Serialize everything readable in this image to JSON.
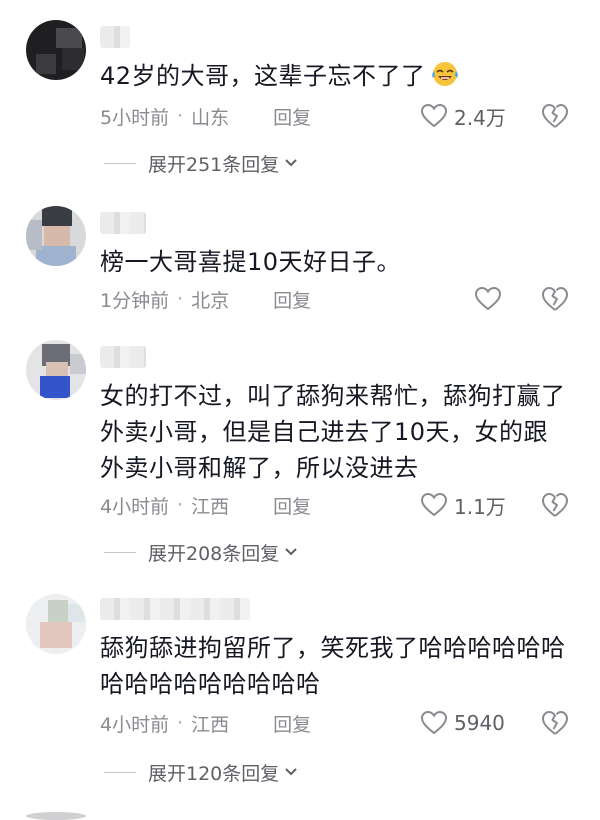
{
  "comments": [
    {
      "text": "42岁的大哥，这辈子忘不了了",
      "emoji": "laughing-crying-emoji",
      "time": "5小时前",
      "location": "山东",
      "reply_label": "回复",
      "likes": "2.4万",
      "expand_label": "展开251条回复"
    },
    {
      "text": "榜一大哥喜提10天好日子。",
      "time": "1分钟前",
      "location": "北京",
      "reply_label": "回复",
      "likes": ""
    },
    {
      "text": "女的打不过，叫了舔狗来帮忙，舔狗打赢了外卖小哥，但是自己进去了10天，女的跟外卖小哥和解了，所以没进去",
      "time": "4小时前",
      "location": "江西",
      "reply_label": "回复",
      "likes": "1.1万",
      "expand_label": "展开208条回复"
    },
    {
      "text": "舔狗舔进拘留所了，笑死我了哈哈哈哈哈哈哈哈哈哈哈哈哈哈哈",
      "time": "4小时前",
      "location": "江西",
      "reply_label": "回复",
      "likes": "5940",
      "expand_label": "展开120条回复"
    }
  ],
  "separator": "·",
  "colors": {
    "text": "#161823",
    "meta": "#8a8b91",
    "icon": "#8a8b91"
  }
}
